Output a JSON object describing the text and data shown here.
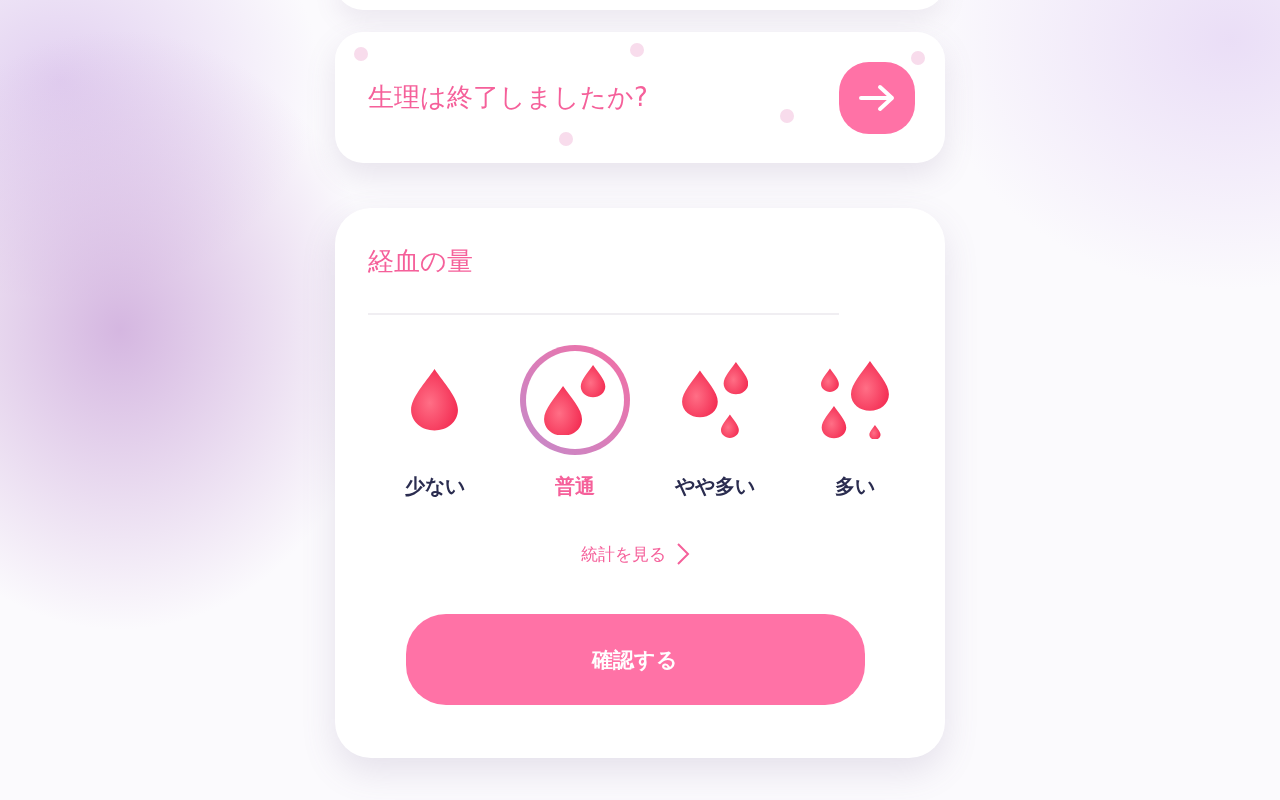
{
  "prompt_card": {
    "question": "生理は終了しましたか?"
  },
  "flow_card": {
    "title": "経血の量",
    "options": [
      {
        "label": "少ない",
        "kind": "one",
        "selected": false
      },
      {
        "label": "普通",
        "kind": "two",
        "selected": true
      },
      {
        "label": "やや多い",
        "kind": "three",
        "selected": false
      },
      {
        "label": "多い",
        "kind": "four",
        "selected": false
      }
    ],
    "stats_link": "統計を見る",
    "confirm_button": "確認する"
  }
}
